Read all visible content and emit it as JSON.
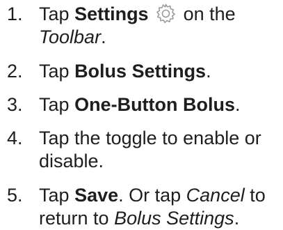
{
  "steps": [
    {
      "number": "1.",
      "pre": "Tap",
      "bold": "Settings",
      "icon": "gear-icon",
      "mid": "on the",
      "italic": "Toolbar",
      "end": "."
    },
    {
      "number": "2.",
      "pre": "Tap",
      "bold": "Bolus Settings",
      "end": "."
    },
    {
      "number": "3.",
      "pre": "Tap",
      "bold": "One-Button Bolus",
      "end": "."
    },
    {
      "number": "4.",
      "line1": "Tap the toggle to enable or",
      "line2": "disable."
    },
    {
      "number": "5.",
      "pre": "Tap",
      "bold": "Save",
      "mid": ". Or tap",
      "italic": "Cancel",
      "mid2": "to",
      "line2_pre": "return to",
      "italic2": "Bolus Settings",
      "end": "."
    }
  ],
  "colors": {
    "text": "#1e1e1e",
    "icon": "#9a9a9a"
  }
}
